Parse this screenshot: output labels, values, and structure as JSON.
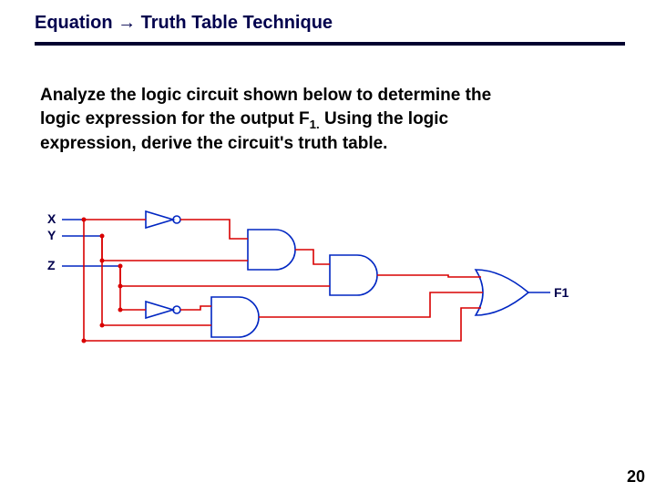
{
  "title": "Equation → Truth Table Technique",
  "body": {
    "line1": "Analyze the logic circuit shown below to determine the",
    "line2_a": "logic expression for the output F",
    "line2_sub": "1.",
    "line2_b": "  Using the logic",
    "line3": "expression, derive the circuit's truth table."
  },
  "inputs": {
    "x": "X",
    "y": "Y",
    "z": "Z"
  },
  "output": "F1",
  "page": "20",
  "circuit": {
    "components": [
      {
        "id": "not1",
        "type": "NOT"
      },
      {
        "id": "not2",
        "type": "NOT"
      },
      {
        "id": "and1",
        "type": "AND2"
      },
      {
        "id": "and2",
        "type": "AND2"
      },
      {
        "id": "and3",
        "type": "AND2"
      },
      {
        "id": "or1",
        "type": "OR3"
      }
    ]
  }
}
